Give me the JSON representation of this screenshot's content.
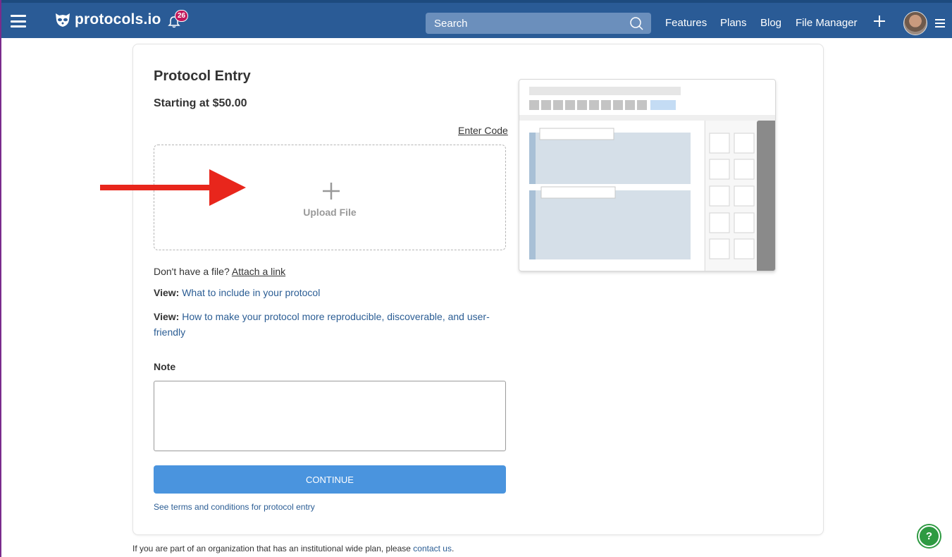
{
  "header": {
    "logo_text": "protocols.io",
    "notification_count": "26",
    "search_placeholder": "Search",
    "nav": [
      "Features",
      "Plans",
      "Blog",
      "File Manager"
    ]
  },
  "form": {
    "title": "Protocol Entry",
    "price": "Starting at $50.00",
    "enter_code": "Enter Code",
    "upload_label": "Upload File",
    "no_file_prefix": "Don't have a file?",
    "attach_link": "Attach a link",
    "view_prefix": "View:",
    "view_link_1": "What to include in your protocol",
    "view_link_2": "How to make your protocol more reproducible, discoverable, and user-friendly",
    "note_label": "Note",
    "note_value": "",
    "continue_label": "CONTINUE",
    "terms_link": "See terms and conditions for protocol entry"
  },
  "footer": {
    "text": "If you are part of an organization that has an institutional wide plan, please",
    "contact_link": "contact us",
    "suffix": "."
  },
  "help_label": "?",
  "colors": {
    "header_bg": "#2a5b96",
    "button_bg": "#4a94de",
    "link": "#2b5d94",
    "arrow": "#e8261c",
    "help": "#2e9a42",
    "badge": "#c2185b"
  }
}
